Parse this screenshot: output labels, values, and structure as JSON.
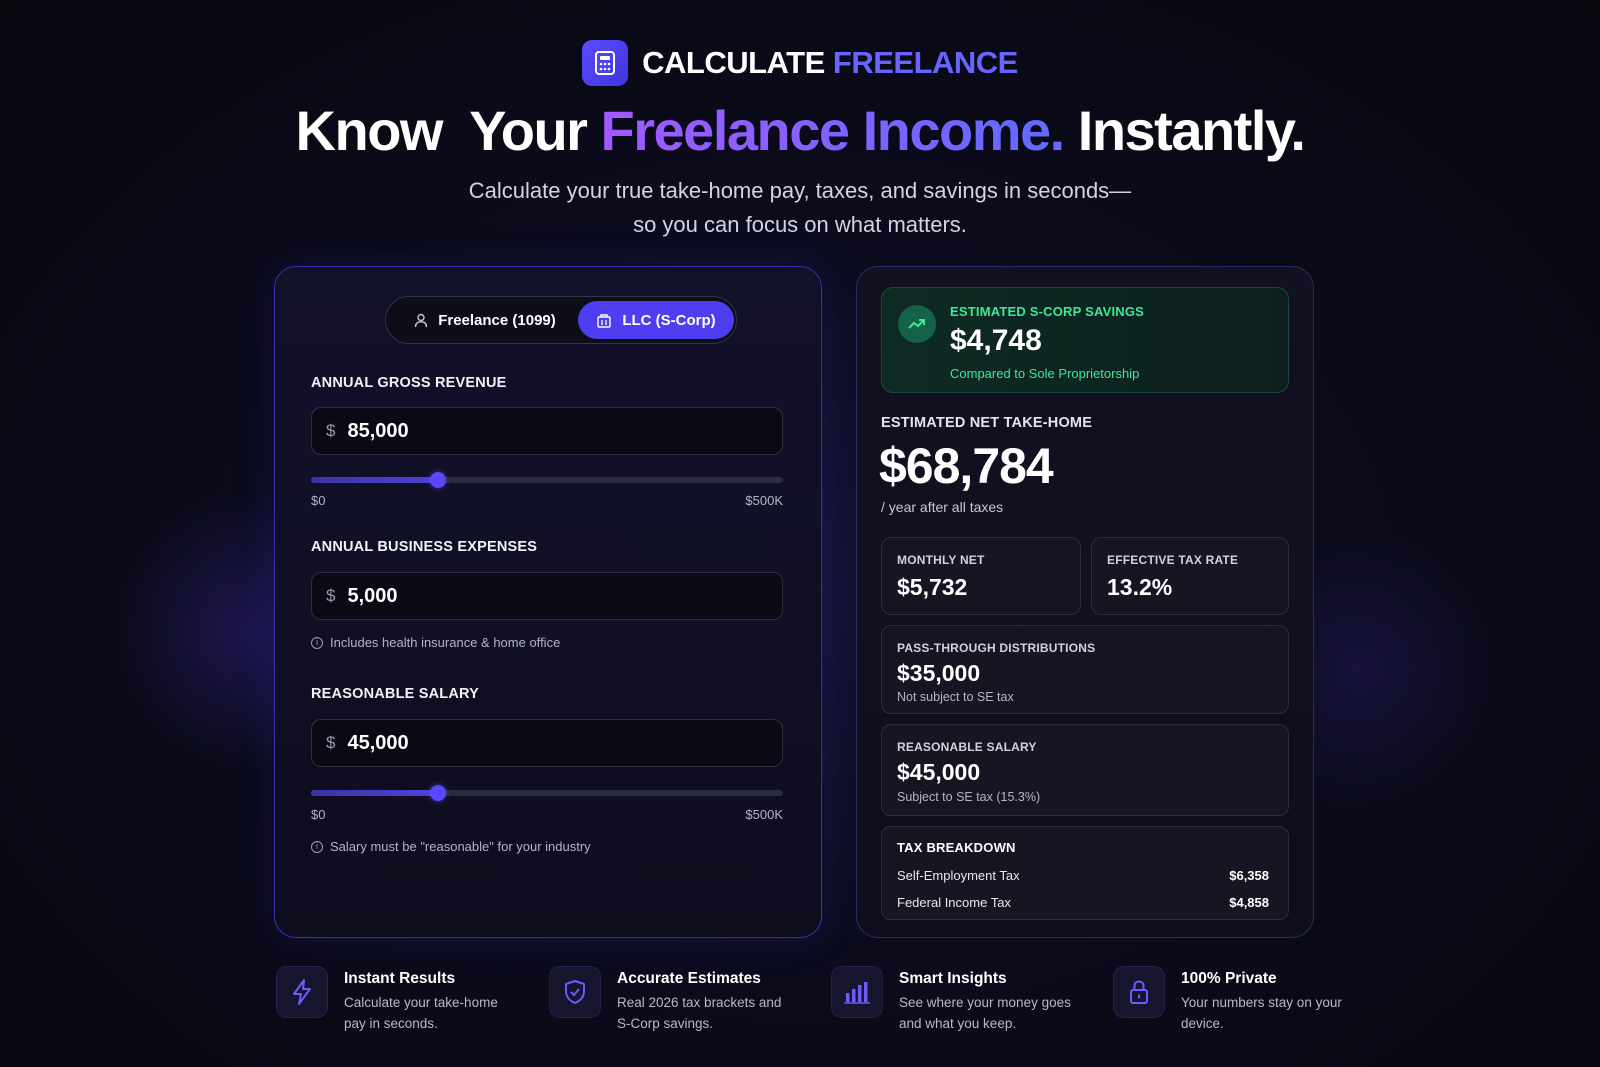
{
  "brand": {
    "name_part1": "CALCULATE",
    "name_part2": "FREELANCE",
    "logo_icon": "calculator-icon"
  },
  "hero": {
    "title_part1": "Know  Your ",
    "title_highlight": "Freelance Income.",
    "title_part2": " Instantly.",
    "subtitle_line1": "Calculate your true take-home pay, taxes, and savings in seconds—",
    "subtitle_line2": "so you can focus on what matters."
  },
  "calculator": {
    "toggle": {
      "options": [
        {
          "label": "Freelance (1099)",
          "icon": "person-icon",
          "selected": false
        },
        {
          "label": "LLC (S-Corp)",
          "icon": "building-icon",
          "selected": true
        }
      ]
    },
    "fields": {
      "revenue": {
        "label": "ANNUAL GROSS REVENUE",
        "currency": "$",
        "value": "85,000",
        "slider_min_label": "$0",
        "slider_max_label": "$500K",
        "slider_fraction": 0.27
      },
      "expenses": {
        "label": "ANNUAL BUSINESS EXPENSES",
        "currency": "$",
        "value": "5,000",
        "note": "Includes health insurance & home office"
      },
      "salary": {
        "label": "REASONABLE SALARY",
        "currency": "$",
        "value": "45,000",
        "slider_min_label": "$0",
        "slider_max_label": "$500K",
        "slider_fraction": 0.27,
        "note": "Salary must be \"reasonable\" for your industry"
      }
    }
  },
  "results": {
    "savings": {
      "label": "ESTIMATED S-CORP SAVINGS",
      "value": "$4,748",
      "sub": "Compared to Sole Proprietorship",
      "icon": "trending-up-icon"
    },
    "net": {
      "label": "ESTIMATED NET TAKE-HOME",
      "value": "$68,784",
      "sub": "/ year after all taxes"
    },
    "monthly": {
      "label": "MONTHLY NET",
      "value": "$5,732"
    },
    "tax_rate": {
      "label": "EFFECTIVE TAX RATE",
      "value": "13.2%"
    },
    "distributions": {
      "label": "PASS-THROUGH DISTRIBUTIONS",
      "value": "$35,000",
      "sub": "Not subject to SE tax"
    },
    "salary": {
      "label": "REASONABLE SALARY",
      "value": "$45,000",
      "sub": "Subject to SE tax (15.3%)"
    },
    "breakdown": {
      "title": "TAX BREAKDOWN",
      "rows": [
        {
          "label": "Self-Employment Tax",
          "amount": "$6,358"
        },
        {
          "label": "Federal Income Tax",
          "amount": "$4,858"
        }
      ]
    }
  },
  "features": [
    {
      "icon": "lightning-icon",
      "title": "Instant Results",
      "desc": "Calculate your take-home pay in seconds."
    },
    {
      "icon": "shield-check-icon",
      "title": "Accurate Estimates",
      "desc": "Real 2026 tax brackets and S-Corp savings."
    },
    {
      "icon": "bar-chart-icon",
      "title": "Smart Insights",
      "desc": "See where your money goes and what you keep."
    },
    {
      "icon": "lock-icon",
      "title": "100% Private",
      "desc": "Your numbers stay on your device."
    }
  ],
  "colors": {
    "accent": "#4f3df0",
    "gradient_start": "#a259ff",
    "gradient_end": "#5f6bff",
    "success": "#3de89a",
    "background": "#0b0b1c"
  }
}
